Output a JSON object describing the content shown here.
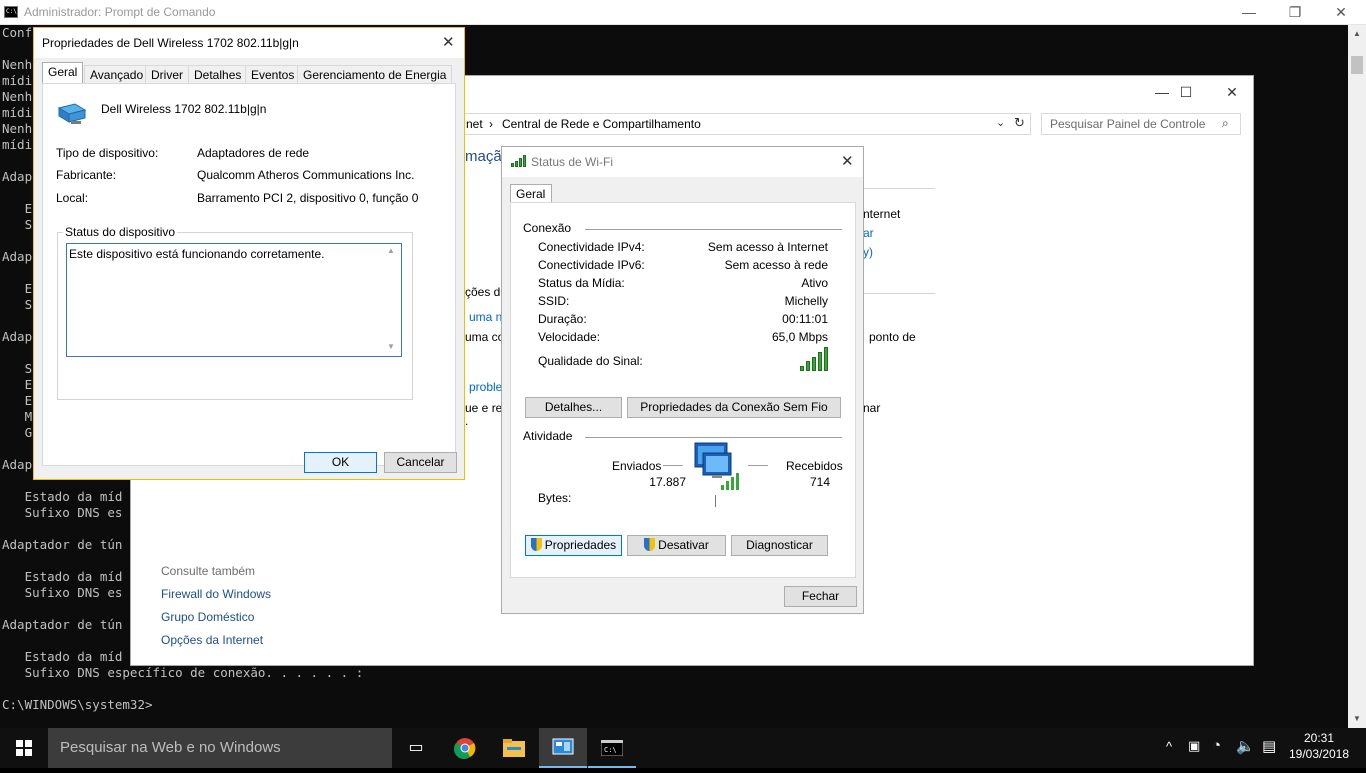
{
  "cmd": {
    "title": "Administrador: Prompt de Comando",
    "lines": [
      "Conf",
      "",
      "Nenh",
      "mídi",
      "Nenh",
      "mídi",
      "Nenh",
      "mídi",
      "",
      "Adap",
      "",
      "   E",
      "   S",
      "",
      "Adap",
      "",
      "   E",
      "   S",
      "",
      "Adap",
      "",
      "   S",
      "   E",
      "   E",
      "   M",
      "   G",
      "",
      "Adap",
      "",
      "   Estado da míd",
      "   Sufixo DNS es",
      "",
      "Adaptador de tún",
      "",
      "   Estado da míd",
      "   Sufixo DNS es",
      "",
      "Adaptador de tún",
      "",
      "   Estado da míd",
      "   Sufixo DNS específico de conexão. . . . . . :",
      "",
      "C:\\WINDOWS\\system32>"
    ]
  },
  "network_center": {
    "address_prefix": "net",
    "address": "Central de Rede e Compartilhamento",
    "search_placeholder": "Pesquisar Painel de Controle",
    "heading_fragment": "mação",
    "right_fragments": [
      "nternet",
      "ar",
      "y)",
      "ponto de",
      "nar"
    ],
    "left_fragments": [
      "ções de",
      "uma n",
      "uma co",
      "proble",
      "ue e re",
      "."
    ],
    "see_also": "Consulte também",
    "links": [
      "Firewall do Windows",
      "Grupo Doméstico",
      "Opções da Internet"
    ]
  },
  "props": {
    "title": "Propriedades de Dell Wireless 1702 802.11b|g|n",
    "tabs": [
      "Geral",
      "Avançado",
      "Driver",
      "Detalhes",
      "Eventos",
      "Gerenciamento de Energia"
    ],
    "device_name": "Dell Wireless 1702 802.11b|g|n",
    "fields": [
      {
        "label": "Tipo de dispositivo:",
        "value": "Adaptadores de rede"
      },
      {
        "label": "Fabricante:",
        "value": "Qualcomm Atheros Communications Inc."
      },
      {
        "label": "Local:",
        "value": "Barramento PCI 2, dispositivo 0, função 0"
      }
    ],
    "status_group": "Status do dispositivo",
    "status_text": "Este dispositivo está funcionando corretamente.",
    "ok": "OK",
    "cancel": "Cancelar"
  },
  "wifi": {
    "title": "Status de Wi-Fi",
    "tab": "Geral",
    "connection_heading": "Conexão",
    "rows": [
      {
        "label": "Conectividade IPv4:",
        "value": "Sem acesso à Internet"
      },
      {
        "label": "Conectividade IPv6:",
        "value": "Sem acesso à rede"
      },
      {
        "label": "Status da Mídia:",
        "value": "Ativo"
      },
      {
        "label": "SSID:",
        "value": "Michelly"
      },
      {
        "label": "Duração:",
        "value": "00:11:01"
      },
      {
        "label": "Velocidade:",
        "value": "65,0 Mbps"
      }
    ],
    "signal_label": "Qualidade do Sinal:",
    "details_btn": "Detalhes...",
    "wireless_props_btn": "Propriedades da Conexão Sem Fio",
    "activity_heading": "Atividade",
    "sent_label": "Enviados",
    "received_label": "Recebidos",
    "bytes_label": "Bytes:",
    "sent_value": "17.887",
    "received_value": "714",
    "properties_btn": "Propriedades",
    "disable_btn": "Desativar",
    "diagnose_btn": "Diagnosticar",
    "close_btn": "Fechar"
  },
  "taskbar": {
    "search": "Pesquisar na Web e no Windows",
    "time": "20:31",
    "date": "19/03/2018"
  }
}
